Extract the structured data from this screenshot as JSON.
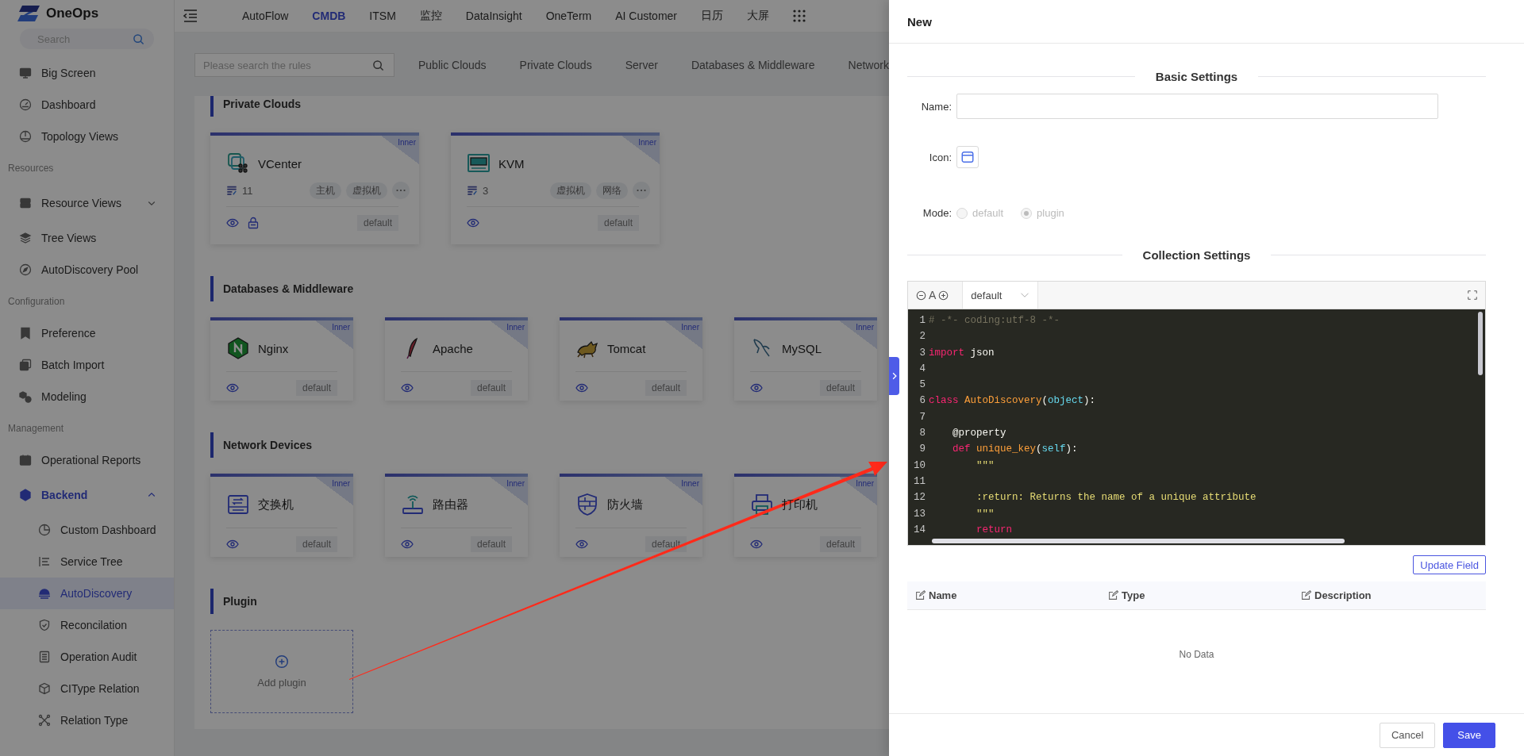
{
  "topbar": {
    "logo": "OneOps",
    "nav": [
      {
        "label": "AutoFlow",
        "selected": false
      },
      {
        "label": "CMDB",
        "selected": true
      },
      {
        "label": "ITSM",
        "selected": false
      },
      {
        "label": "监控",
        "selected": false
      },
      {
        "label": "DataInsight",
        "selected": false
      },
      {
        "label": "OneTerm",
        "selected": false
      },
      {
        "label": "AI Customer",
        "selected": false
      },
      {
        "label": "日历",
        "selected": false
      },
      {
        "label": "大屏",
        "selected": false
      }
    ]
  },
  "sidebar": {
    "search": {
      "placeholder": "Search"
    },
    "items": [
      {
        "kind": "item",
        "label": "Big Screen",
        "selected": false
      },
      {
        "kind": "item",
        "label": "Dashboard",
        "selected": false
      },
      {
        "kind": "item",
        "label": "Topology Views",
        "selected": false
      },
      {
        "kind": "header",
        "label": "Resources"
      },
      {
        "kind": "item",
        "label": "Resource Views",
        "selected": false,
        "expanded": false
      },
      {
        "kind": "item",
        "label": "Tree Views",
        "selected": false
      },
      {
        "kind": "item",
        "label": "AutoDiscovery Pool",
        "selected": false
      },
      {
        "kind": "header",
        "label": "Configuration"
      },
      {
        "kind": "item",
        "label": "Preference",
        "selected": false
      },
      {
        "kind": "item",
        "label": "Batch Import",
        "selected": false
      },
      {
        "kind": "item",
        "label": "Modeling",
        "selected": false
      },
      {
        "kind": "header",
        "label": "Management"
      },
      {
        "kind": "item",
        "label": "Operational Reports",
        "selected": false
      },
      {
        "kind": "item",
        "label": "Backend",
        "selected": false,
        "expanded": true,
        "children": [
          {
            "label": "Custom Dashboard",
            "selected": false
          },
          {
            "label": "Service Tree",
            "selected": false
          },
          {
            "label": "AutoDiscovery",
            "selected": true
          },
          {
            "label": "Reconcilation",
            "selected": false
          },
          {
            "label": "Operation Audit",
            "selected": false
          },
          {
            "label": "CIType Relation",
            "selected": false
          },
          {
            "label": "Relation Type",
            "selected": false
          }
        ]
      }
    ]
  },
  "rules": {
    "search": {
      "placeholder": "Please search the rules"
    },
    "categories": [
      {
        "label": "Public Clouds",
        "selected": false
      },
      {
        "label": "Private Clouds",
        "selected": false
      },
      {
        "label": "Server",
        "selected": false
      },
      {
        "label": "Databases & Middleware",
        "selected": false
      },
      {
        "label": "Network",
        "selected": false
      }
    ],
    "sections": [
      {
        "kind": "cards",
        "title": "Private Clouds",
        "cards": [
          {
            "name": "VCenter",
            "badge": "Inner",
            "count": "11",
            "tags": [
              "主机",
              "虚拟机"
            ],
            "secured": true,
            "mode": "default"
          },
          {
            "name": "KVM",
            "badge": "Inner",
            "count": "3",
            "tags": [
              "虚拟机",
              "网络"
            ],
            "secured": false,
            "mode": "default"
          }
        ]
      },
      {
        "kind": "cards",
        "title": "Databases & Middleware",
        "cards": [
          {
            "name": "Nginx",
            "badge": "Inner",
            "secured": false,
            "mode": "default"
          },
          {
            "name": "Apache",
            "badge": "Inner",
            "secured": false,
            "mode": "default"
          },
          {
            "name": "Tomcat",
            "badge": "Inner",
            "secured": false,
            "mode": "default"
          },
          {
            "name": "MySQL",
            "badge": "Inner",
            "secured": false,
            "mode": "default"
          }
        ]
      },
      {
        "kind": "cards",
        "title": "Network Devices",
        "cards": [
          {
            "name": "交换机",
            "badge": "Inner",
            "secured": false,
            "mode": "default"
          },
          {
            "name": "路由器",
            "badge": "Inner",
            "secured": false,
            "mode": "default"
          },
          {
            "name": "防火墙",
            "badge": "Inner",
            "secured": false,
            "mode": "default"
          },
          {
            "name": "打印机",
            "badge": "Inner",
            "secured": false,
            "mode": "default"
          }
        ]
      },
      {
        "kind": "plugin",
        "title": "Plugin",
        "add_label": "Add plugin"
      }
    ]
  },
  "drawer": {
    "title": "New",
    "basic_settings": {
      "heading": "Basic Settings",
      "name": {
        "label": "Name:"
      },
      "icon": {
        "label": "Icon:"
      },
      "mode": {
        "label": "Mode:",
        "options": [
          {
            "label": "default",
            "selected": false,
            "disabled": true
          },
          {
            "label": "plugin",
            "selected": true,
            "disabled": true
          }
        ]
      }
    },
    "collection_settings": {
      "heading": "Collection Settings",
      "editor": {
        "font_label": "A",
        "theme": "default",
        "lines": [
          {
            "number": "1",
            "tokens": [
              {
                "kind": "comment",
                "text": "# -*- coding:utf-8 -*-"
              }
            ]
          },
          {
            "number": "2"
          },
          {
            "number": "3",
            "tokens": [
              {
                "kind": "keyword",
                "text": "import"
              },
              {
                "kind": "plain",
                "text": " json"
              }
            ]
          },
          {
            "number": "4"
          },
          {
            "number": "5"
          },
          {
            "number": "6",
            "tokens": [
              {
                "kind": "keyword",
                "text": "class "
              },
              {
                "kind": "name",
                "text": "AutoDiscovery"
              },
              {
                "kind": "plain",
                "text": "("
              },
              {
                "kind": "builtin",
                "text": "object"
              },
              {
                "kind": "plain",
                "text": "):"
              }
            ]
          },
          {
            "number": "7"
          },
          {
            "number": "8",
            "tokens": [
              {
                "kind": "plain",
                "text": "    @property"
              }
            ]
          },
          {
            "number": "9",
            "tokens": [
              {
                "kind": "keyword",
                "text": "    def "
              },
              {
                "kind": "name",
                "text": "unique_key"
              },
              {
                "kind": "plain",
                "text": "("
              },
              {
                "kind": "builtin",
                "text": "self"
              },
              {
                "kind": "plain",
                "text": "):"
              }
            ]
          },
          {
            "number": "10",
            "tokens": [
              {
                "kind": "string",
                "text": "        \"\"\""
              }
            ]
          },
          {
            "number": "11"
          },
          {
            "number": "12",
            "tokens": [
              {
                "kind": "string",
                "text": "        :return: Returns the name of a unique attribute"
              }
            ]
          },
          {
            "number": "13",
            "tokens": [
              {
                "kind": "string",
                "text": "        \"\"\""
              }
            ]
          },
          {
            "number": "14",
            "tokens": [
              {
                "kind": "keyword",
                "text": "        return"
              }
            ]
          }
        ]
      },
      "update_button": "Update Field",
      "table": {
        "columns": [
          "Name",
          "Type",
          "Description"
        ],
        "empty_text": "No Data"
      }
    },
    "footer": {
      "buttons": [
        {
          "label": "Cancel",
          "kind": "default"
        },
        {
          "label": "Save",
          "kind": "primary"
        }
      ]
    }
  }
}
